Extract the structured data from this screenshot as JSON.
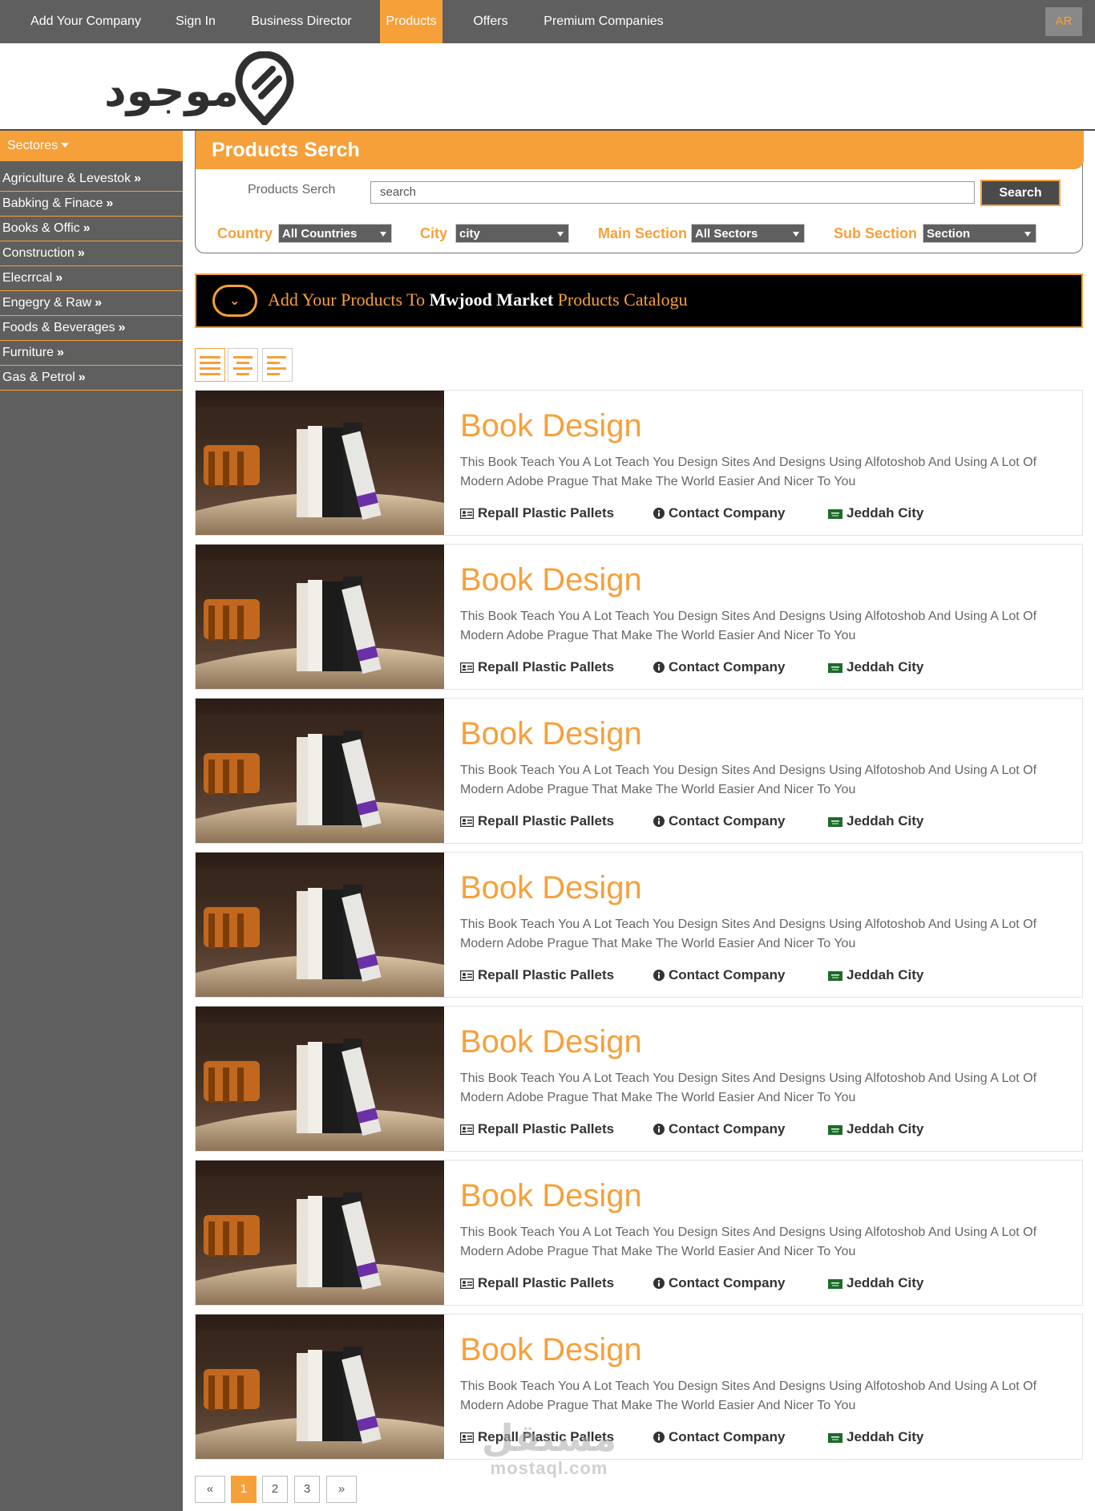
{
  "nav": {
    "items": [
      "Add Your Company",
      "Sign In",
      "Business Director",
      "Products",
      "Offers",
      "Premium Companies"
    ],
    "active_index": 3,
    "lang": "AR"
  },
  "logo": {
    "text": "موجود"
  },
  "sidebar": {
    "heading": "Sectores",
    "items": [
      "Agriculture & Levestok",
      "Babking & Finace",
      "Books & Offic",
      "Construction",
      "Elecrrcal",
      "Engegry & Raw",
      "Foods & Beverages",
      "Furniture",
      "Gas & Petrol"
    ]
  },
  "search": {
    "heading": "Products Serch",
    "label": "Products Serch",
    "placeholder": "search",
    "button": "Search",
    "filters": {
      "country_label": "Country",
      "country_value": "All Countries",
      "city_label": "City",
      "city_value": "city",
      "main_label": "Main Section",
      "main_value": "All Sectors",
      "sub_label": "Sub Section",
      "sub_value": "Section"
    }
  },
  "banner": {
    "prefix": "Add Your Products To ",
    "brand": "Mwjood Market",
    "suffix": " Products Catalogu"
  },
  "products": [
    {
      "title": "Book Design",
      "description": "This Book Teach You A Lot Teach You Design Sites And Designs Using Alfotoshob And Using A Lot Of Modern Adobe Prague That Make The World Easier And Nicer To You",
      "company": "Repall Plastic Pallets",
      "contact": "Contact Company",
      "city": "Jeddah City"
    },
    {
      "title": "Book Design",
      "description": "This Book Teach You A Lot Teach You Design Sites And Designs Using Alfotoshob And Using A Lot Of Modern Adobe Prague That Make The World Easier And Nicer To You",
      "company": "Repall Plastic Pallets",
      "contact": "Contact Company",
      "city": "Jeddah City"
    },
    {
      "title": "Book Design",
      "description": "This Book Teach You A Lot Teach You Design Sites And Designs Using Alfotoshob And Using A Lot Of Modern Adobe Prague That Make The World Easier And Nicer To You",
      "company": "Repall Plastic Pallets",
      "contact": "Contact Company",
      "city": "Jeddah City"
    },
    {
      "title": "Book Design",
      "description": "This Book Teach You A Lot Teach You Design Sites And Designs Using Alfotoshob And Using A Lot Of Modern Adobe Prague That Make The World Easier And Nicer To You",
      "company": "Repall Plastic Pallets",
      "contact": "Contact Company",
      "city": "Jeddah City"
    },
    {
      "title": "Book Design",
      "description": "This Book Teach You A Lot Teach You Design Sites And Designs Using Alfotoshob And Using A Lot Of Modern Adobe Prague That Make The World Easier And Nicer To You",
      "company": "Repall Plastic Pallets",
      "contact": "Contact Company",
      "city": "Jeddah City"
    },
    {
      "title": "Book Design",
      "description": "This Book Teach You A Lot Teach You Design Sites And Designs Using Alfotoshob And Using A Lot Of Modern Adobe Prague That Make The World Easier And Nicer To You",
      "company": "Repall Plastic Pallets",
      "contact": "Contact Company",
      "city": "Jeddah City"
    },
    {
      "title": "Book Design",
      "description": "This Book Teach You A Lot Teach You Design Sites And Designs Using Alfotoshob And Using A Lot Of Modern Adobe Prague That Make The World Easier And Nicer To You",
      "company": "Repall Plastic Pallets",
      "contact": "Contact Company",
      "city": "Jeddah City"
    }
  ],
  "pagination": {
    "prev": "«",
    "pages": [
      "1",
      "2",
      "3"
    ],
    "current": "1",
    "next": "»"
  },
  "watermark": {
    "arabic": "مستقل",
    "latin": "mostaql.com"
  },
  "colors": {
    "accent": "#f6a03a",
    "nav_bg": "#5f5f5f",
    "banner_bg": "#000000"
  }
}
